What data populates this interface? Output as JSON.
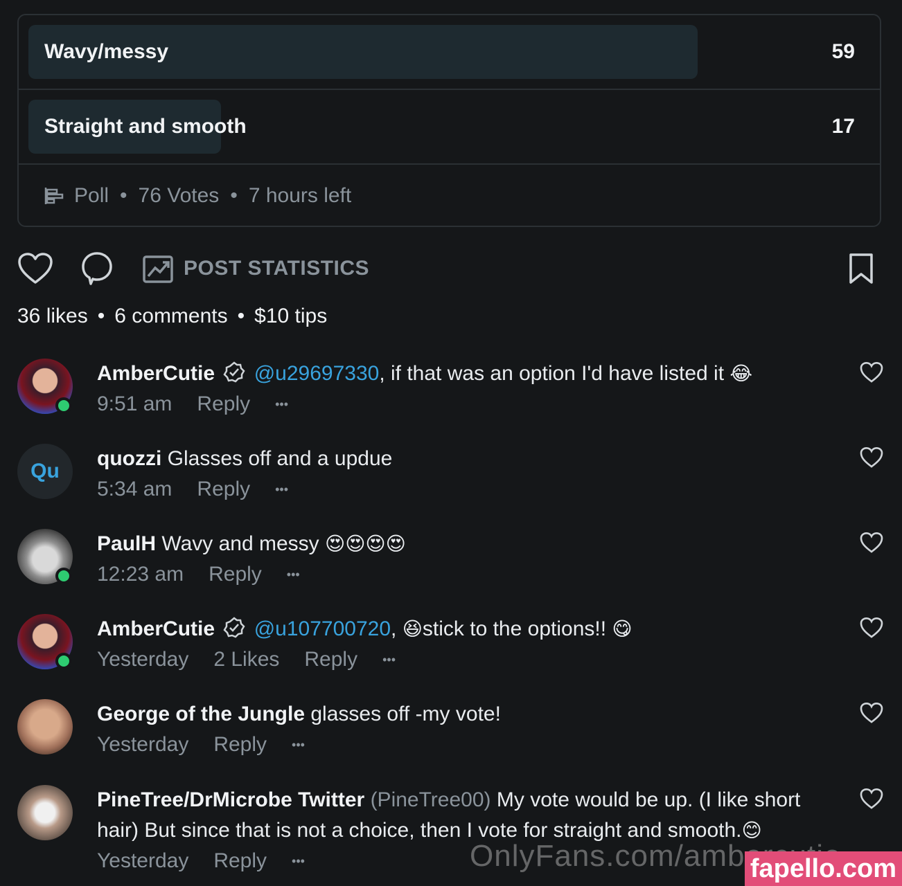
{
  "poll": {
    "options": [
      {
        "label": "Wavy/messy",
        "count": "59",
        "fill": 0.78
      },
      {
        "label": "Straight and smooth",
        "count": "17",
        "fill": 0.22
      }
    ],
    "footer": {
      "type": "Poll",
      "votes": "76 Votes",
      "time_left": "7 hours left"
    }
  },
  "actions": {
    "like_icon": "heart-icon",
    "comment_icon": "comment-bubble-icon",
    "stats_icon": "chart-icon",
    "stats_label": "POST STATISTICS",
    "bookmark_icon": "bookmark-icon"
  },
  "summary": {
    "likes": "36 likes",
    "comments": "6 comments",
    "tips": "$10 tips",
    "dot": "•"
  },
  "comments": [
    {
      "user": "AmberCutie",
      "verified": true,
      "mention": "@u29697330",
      "text": ", if that was an option I'd have listed it",
      "emoji": "😂",
      "time": "9:51 am",
      "likes": "",
      "reply": "Reply",
      "more": "•••",
      "online": true
    },
    {
      "user": "quozzi",
      "initials": "Qu",
      "text": " Glasses off and a updue",
      "time": "5:34 am",
      "reply": "Reply",
      "more": "•••",
      "online": false
    },
    {
      "user": "PaulH",
      "text": " Wavy and messy",
      "emoji": "😍😍😍😍",
      "time": "12:23 am",
      "reply": "Reply",
      "more": "•••",
      "online": true
    },
    {
      "user": "AmberCutie",
      "verified": true,
      "mention": "@u107700720",
      "text": ", ",
      "emoji_pre": "😆",
      "text2": "stick to the options!! ",
      "emoji": "😋",
      "time": "Yesterday",
      "likes": "2 Likes",
      "reply": "Reply",
      "more": "•••",
      "online": true
    },
    {
      "user": "George of the Jungle",
      "text": " glasses off -my vote!",
      "time": "Yesterday",
      "reply": "Reply",
      "more": "•••",
      "online": false
    },
    {
      "user": "PineTree/DrMicrobe Twitter",
      "handle": "(PineTree00)",
      "text": " My vote would be up. (I like short hair) But since that is not a choice, then I vote for straight and smooth.",
      "emoji": "😊",
      "time": "Yesterday",
      "reply": "Reply",
      "more": "•••",
      "online": false
    }
  ],
  "watermark": "OnlyFans.com/ambercutie",
  "site_badge": "fapello.com",
  "colors": {
    "accent": "#39a3de",
    "online": "#2ecc71",
    "background": "#151719"
  }
}
